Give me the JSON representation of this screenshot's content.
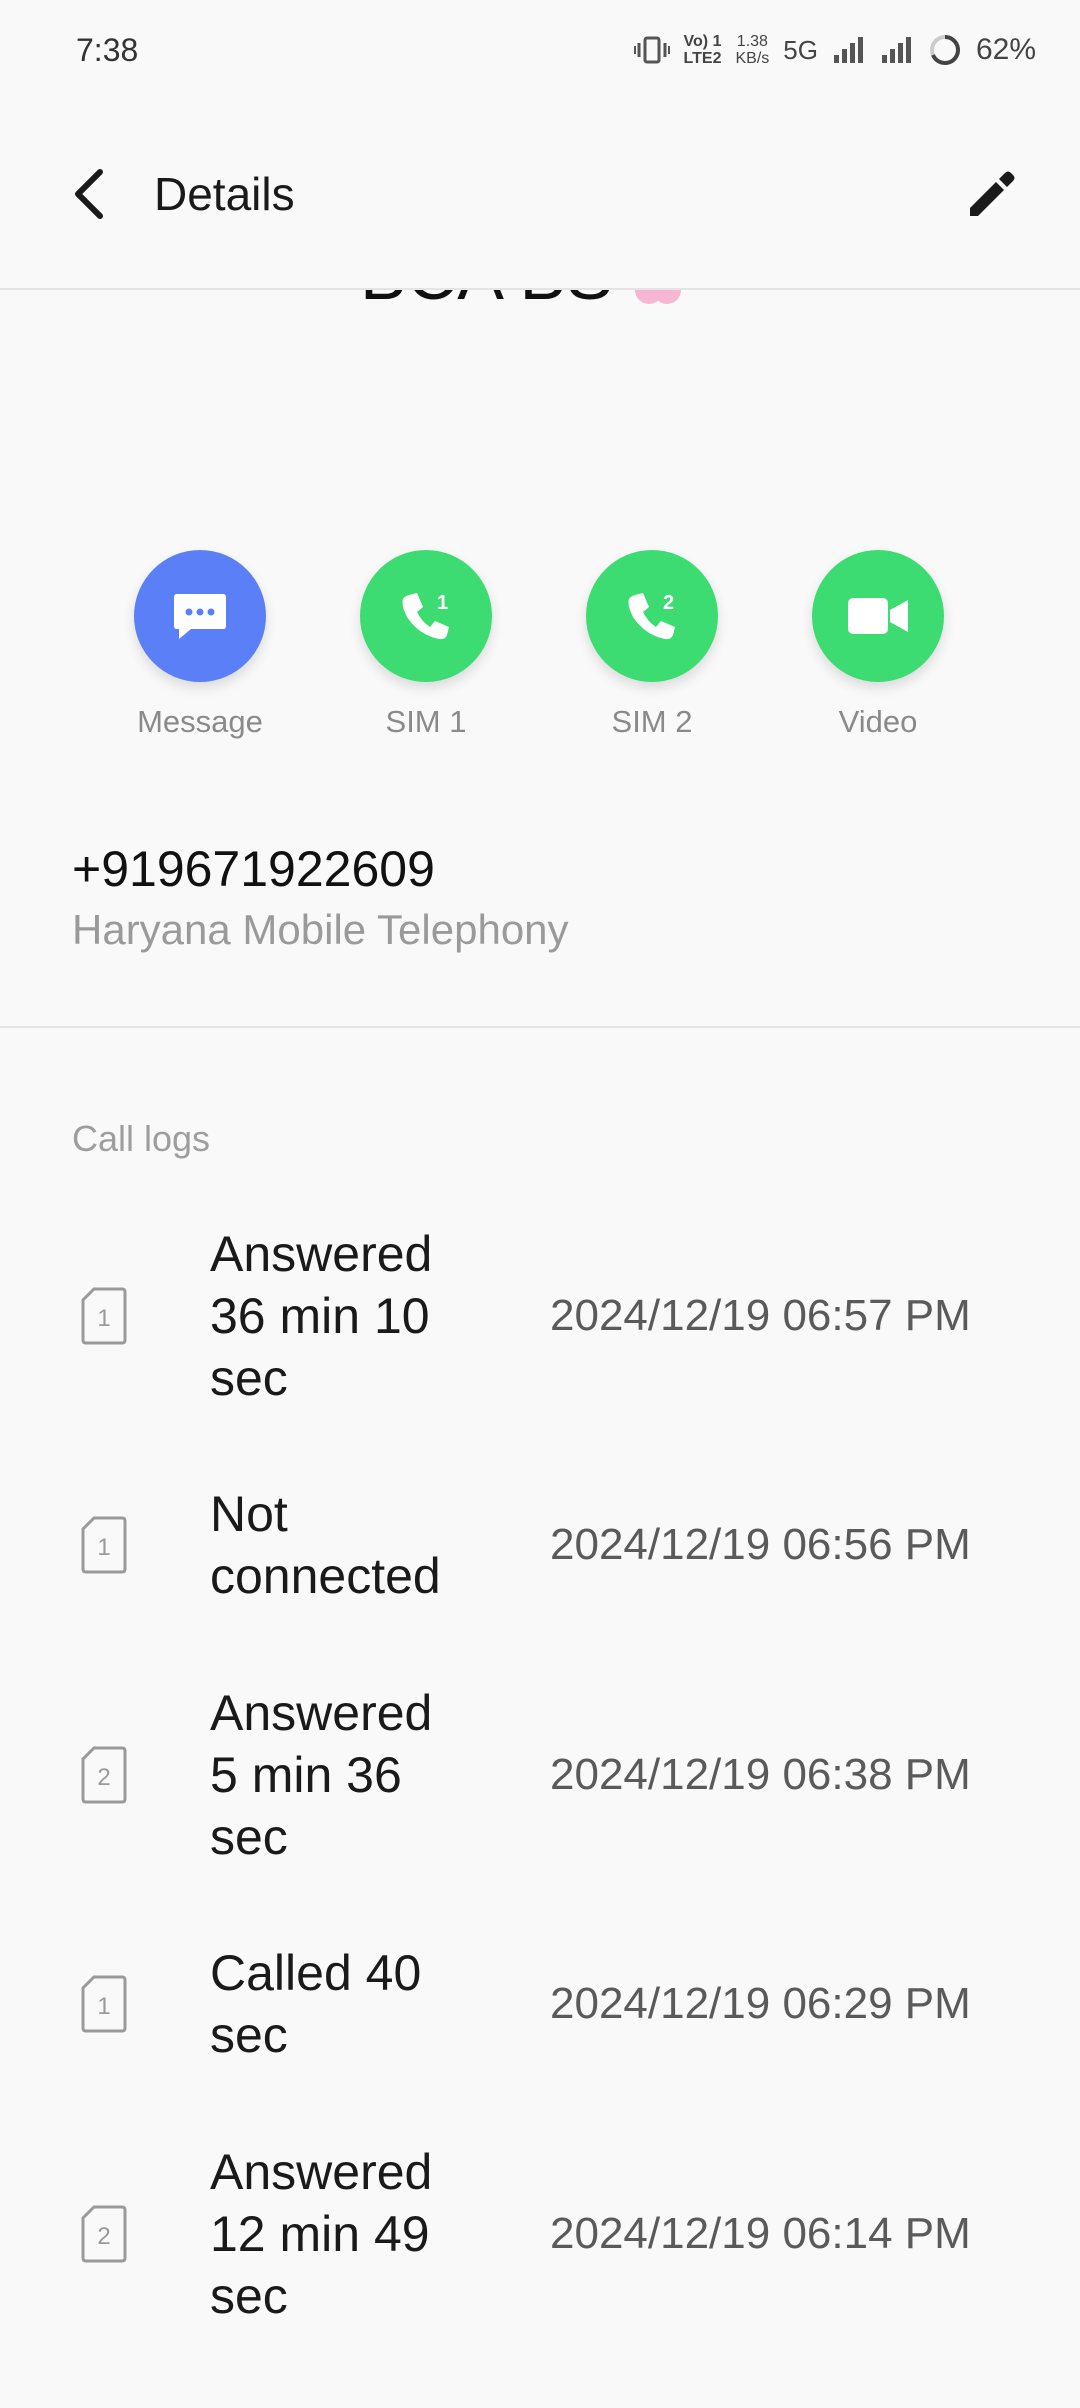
{
  "status_bar": {
    "time": "7:38",
    "volte": "Vo) 1\nLTE2",
    "speed": "1.38\nKB/s",
    "network": "5G",
    "battery": "62%"
  },
  "header": {
    "title": "Details"
  },
  "contact": {
    "name_partial": "BCA BS"
  },
  "actions": [
    {
      "label": "Message",
      "icon": "message-icon",
      "color": "#5b7ff7"
    },
    {
      "label": "SIM 1",
      "icon": "phone-sim1-icon",
      "color": "#3ddc72"
    },
    {
      "label": "SIM 2",
      "icon": "phone-sim2-icon",
      "color": "#3ddc72"
    },
    {
      "label": "Video",
      "icon": "video-icon",
      "color": "#3ddc72"
    }
  ],
  "phone": {
    "number": "+919671922609",
    "carrier": "Haryana Mobile Telephony"
  },
  "call_logs": {
    "title": "Call logs",
    "items": [
      {
        "sim": "1",
        "status": "Answered\n  36 min 10\nsec",
        "time": "2024/12/19 06:57 PM"
      },
      {
        "sim": "1",
        "status": "Not\nconnected",
        "time": "2024/12/19 06:56 PM"
      },
      {
        "sim": "2",
        "status": "Answered\n  5 min 36\nsec",
        "time": "2024/12/19 06:38 PM"
      },
      {
        "sim": "1",
        "status": "Called    40\nsec",
        "time": "2024/12/19 06:29 PM"
      },
      {
        "sim": "2",
        "status": "Answered\n  12 min 49\nsec",
        "time": "2024/12/19 06:14 PM"
      }
    ]
  }
}
